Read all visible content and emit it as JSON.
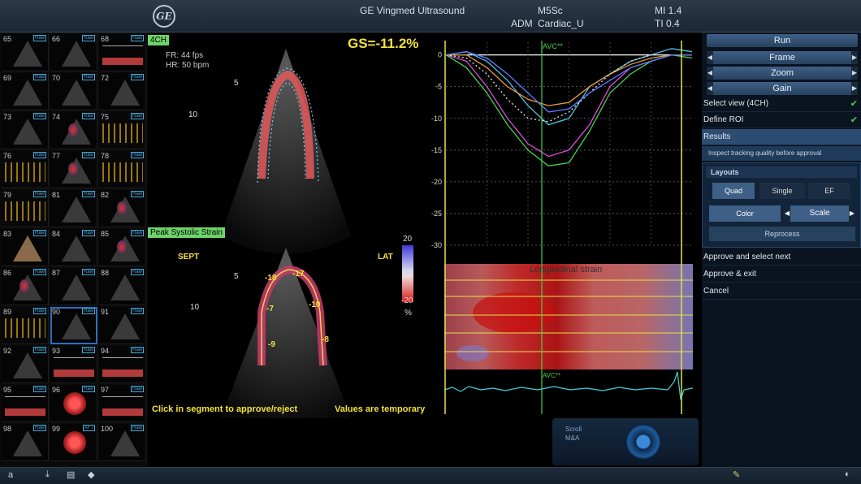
{
  "topbar": {
    "logo": "GE",
    "title": "GE Vingmed Ultrasound",
    "probe": "M5Sc",
    "adm_label": "ADM",
    "preset": "Cardiac_U",
    "mi": "MI 1.4",
    "ti": "TI 0.4"
  },
  "thumbnails": [
    {
      "num": "65",
      "kind": "echo"
    },
    {
      "num": "66",
      "kind": "echo"
    },
    {
      "num": "68",
      "kind": "mmode"
    },
    {
      "num": "69",
      "kind": "echo"
    },
    {
      "num": "70",
      "kind": "echo"
    },
    {
      "num": "72",
      "kind": "echo"
    },
    {
      "num": "73",
      "kind": "echo"
    },
    {
      "num": "74",
      "kind": "color"
    },
    {
      "num": "75",
      "kind": "doppler"
    },
    {
      "num": "76",
      "kind": "doppler"
    },
    {
      "num": "77",
      "kind": "color"
    },
    {
      "num": "78",
      "kind": "doppler"
    },
    {
      "num": "79",
      "kind": "doppler"
    },
    {
      "num": "81",
      "kind": "echo"
    },
    {
      "num": "82",
      "kind": "color"
    },
    {
      "num": "83",
      "kind": "tan"
    },
    {
      "num": "84",
      "kind": "echo"
    },
    {
      "num": "85",
      "kind": "color"
    },
    {
      "num": "86",
      "kind": "color"
    },
    {
      "num": "87",
      "kind": "echo"
    },
    {
      "num": "88",
      "kind": "echo"
    },
    {
      "num": "89",
      "kind": "doppler"
    },
    {
      "num": "90",
      "kind": "echo",
      "selected": true
    },
    {
      "num": "91",
      "kind": "echo"
    },
    {
      "num": "92",
      "kind": "echo"
    },
    {
      "num": "93",
      "kind": "graph"
    },
    {
      "num": "94",
      "kind": "graph"
    },
    {
      "num": "95",
      "kind": "graph"
    },
    {
      "num": "96",
      "kind": "strain"
    },
    {
      "num": "97",
      "kind": "graph"
    },
    {
      "num": "98",
      "kind": "echo"
    },
    {
      "num": "99",
      "kind": "strain"
    },
    {
      "num": "100",
      "kind": "echo"
    }
  ],
  "thumb_badge": "Raw",
  "thumb_badge_aft": "AFT",
  "viewer": {
    "view_tag": "4CH",
    "fr": "FR: 44 fps",
    "hr": "HR: 50 bpm",
    "gs": "GS=-11.2%",
    "depth5": "5",
    "depth10": "10",
    "depth5b": "5",
    "depth10b": "10",
    "peak_tag": "Peak Systolic Strain",
    "sept": "SEPT",
    "lat": "LAT",
    "scale_top": "20",
    "scale_bottom": "-20",
    "scale_unit": "%",
    "seg_values": [
      "-18",
      "-17",
      "-7",
      "-10",
      "-9",
      "-8"
    ],
    "footer_left": "Click in segment to approve/reject",
    "footer_right": "Values are temporary"
  },
  "graph": {
    "marker": "AVC**",
    "marker2": "AVC**",
    "heatmap_title": "Longitudinal strain"
  },
  "chart_data": {
    "type": "line",
    "yticks": [
      "0",
      "-5",
      "-10",
      "-15",
      "-20",
      "-25",
      "-30"
    ],
    "ylim": [
      -30,
      2
    ],
    "series": [
      {
        "color": "#4fc3e8",
        "values": [
          0,
          0.5,
          -1,
          -4,
          -8,
          -11,
          -10,
          -5,
          -3,
          -1,
          0,
          1,
          0.5
        ]
      },
      {
        "color": "#e04ae0",
        "values": [
          0,
          -1,
          -5,
          -10,
          -14,
          -16,
          -15,
          -11,
          -5,
          -2,
          -1,
          0,
          0
        ]
      },
      {
        "color": "#46d04a",
        "values": [
          0,
          -2,
          -6,
          -11,
          -15,
          -17.5,
          -17,
          -12,
          -6,
          -3,
          -1,
          0,
          -0.5
        ]
      },
      {
        "color": "#e89a3a",
        "values": [
          0,
          0,
          -2,
          -5,
          -7,
          -8,
          -7.5,
          -5,
          -3,
          -1.5,
          -0.5,
          0,
          0
        ]
      },
      {
        "color": "#e8e8e8",
        "values": [
          0,
          -0.5,
          -3,
          -7,
          -10,
          -10.5,
          -9,
          -6,
          -3,
          -1,
          0,
          0,
          0
        ]
      },
      {
        "color": "#5f7cff",
        "values": [
          0,
          0.5,
          -0.5,
          -3,
          -6,
          -9,
          -8.5,
          -6,
          -4,
          -2,
          -1,
          0,
          0
        ]
      }
    ]
  },
  "panel": {
    "run": "Run",
    "frame": "Frame",
    "zoom": "Zoom",
    "gain": "Gain",
    "select_view": "Select view (4CH)",
    "define_roi": "Define ROI",
    "results": "Results",
    "inspect": "Inspect tracking quality before approval",
    "layouts": "Layouts",
    "quad": "Quad",
    "single": "Single",
    "ef": "EF",
    "color": "Color",
    "scale": "Scale",
    "reprocess": "Reprocess",
    "approve_next": "Approve and select next",
    "approve_exit": "Approve & exit",
    "cancel": "Cancel"
  },
  "scrollpad": {
    "line1": "Scroll",
    "line2": "M&A"
  },
  "bottombar": {
    "left_label": "a"
  },
  "colors": {
    "accent_yellow": "#f2e23a",
    "tag_green": "#6ed36a",
    "panel_blue": "#3e5f86"
  }
}
